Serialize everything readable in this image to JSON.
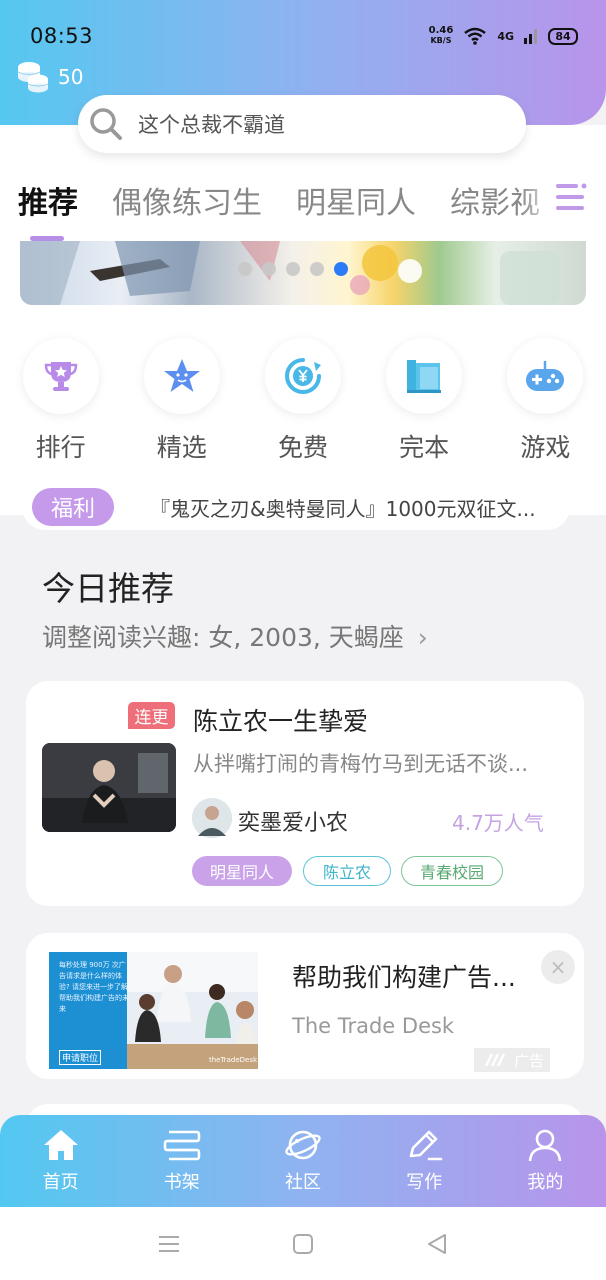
{
  "status_bar": {
    "time": "08:53",
    "net_speed_value": "0.46",
    "net_speed_unit": "KB/S",
    "signal": "4G",
    "battery": "84"
  },
  "header": {
    "coins": "50"
  },
  "search": {
    "placeholder": "这个总裁不霸道"
  },
  "tabs": [
    {
      "label": "推荐",
      "active": true
    },
    {
      "label": "偶像练习生"
    },
    {
      "label": "明星同人"
    },
    {
      "label": "综影视"
    }
  ],
  "quick_links": [
    {
      "label": "排行",
      "icon": "trophy-icon"
    },
    {
      "label": "精选",
      "icon": "star-icon"
    },
    {
      "label": "免费",
      "icon": "yuan-refresh-icon"
    },
    {
      "label": "完本",
      "icon": "book-icon"
    },
    {
      "label": "游戏",
      "icon": "gamepad-icon"
    }
  ],
  "welfare": {
    "badge": "福利",
    "text": "『鬼灭之刃&奥特曼同人』1000元双征文..."
  },
  "today": {
    "title": "今日推荐",
    "subtitle": "调整阅读兴趣: 女, 2003, 天蝎座",
    "chevron": "›"
  },
  "book": {
    "badge": "连更",
    "title": "陈立农一生挚爱",
    "description": "从拌嘴打闹的青梅竹马到无话不谈...",
    "author": "奕墨爱小农",
    "popularity": "4.7万人气",
    "tags": [
      "明星同人",
      "陈立农",
      "青春校园"
    ]
  },
  "ad": {
    "title": "帮助我们构建广告...",
    "advertiser": "The Trade Desk",
    "label": "广告",
    "close": "×",
    "image_text": "每秒处理 900万 次广告请求是什么样的体验? 请您来进一步了解 帮助我们构建广告的未来",
    "image_button": "申请职位",
    "image_brand": "theTradeDesk"
  },
  "bottom_nav": [
    {
      "label": "首页",
      "icon": "home-icon",
      "active": true
    },
    {
      "label": "书架",
      "icon": "bookshelf-icon"
    },
    {
      "label": "社区",
      "icon": "planet-icon"
    },
    {
      "label": "写作",
      "icon": "pen-icon"
    },
    {
      "label": "我的",
      "icon": "profile-icon"
    }
  ],
  "colors": {
    "accent_purple": "#c59aeb",
    "gradient_left": "#55c8f0",
    "gradient_right": "#b894ea",
    "dot_active": "#2b7cf6"
  }
}
